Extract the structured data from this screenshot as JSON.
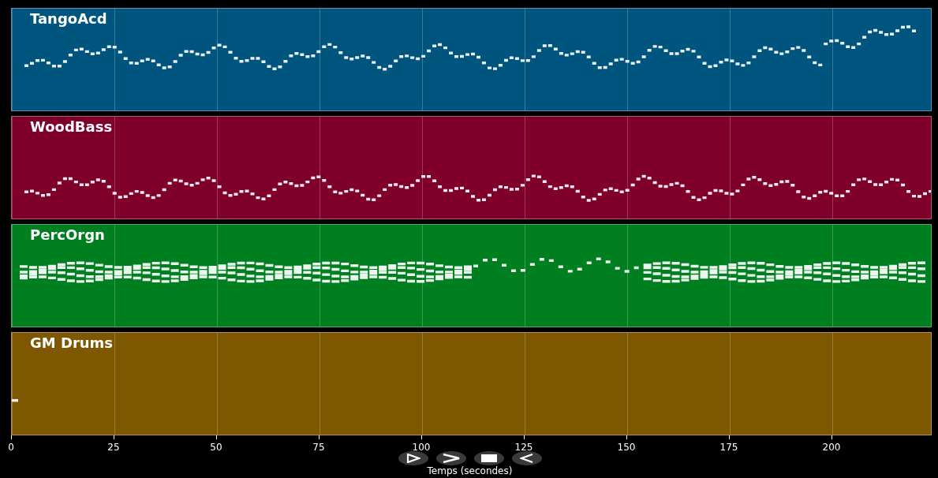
{
  "tracks": [
    {
      "name": "TangoAcd",
      "color": "#00557f",
      "kind": "melody"
    },
    {
      "name": "WoodBass",
      "color": "#7f002a",
      "kind": "melody"
    },
    {
      "name": "PercOrgn",
      "color": "#007f20",
      "kind": "chords"
    },
    {
      "name": "GM Drums",
      "color": "#7f5700",
      "kind": "sparse"
    }
  ],
  "axis": {
    "ticks": [
      "0",
      "25",
      "50",
      "75",
      "100",
      "125",
      "150",
      "175",
      "200"
    ],
    "label": "Temps (secondes)"
  },
  "controls": [
    {
      "kind": "play"
    },
    {
      "kind": "forward"
    },
    {
      "kind": "stop"
    },
    {
      "kind": "reverse"
    }
  ]
}
